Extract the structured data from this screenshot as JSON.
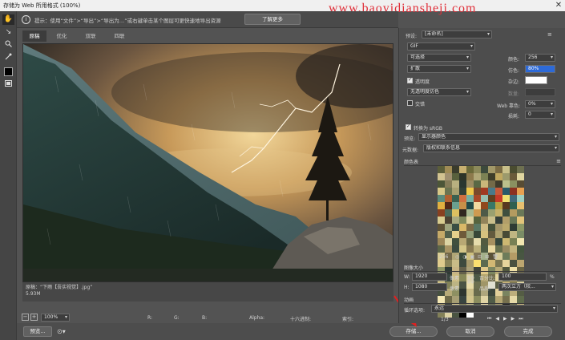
{
  "window": {
    "title": "存储为 Web 所用格式 (100%)",
    "close": "✕"
  },
  "watermark": "www.baoyidiansheji.com",
  "tools": [
    {
      "name": "hand-tool-icon",
      "glyph": "✋"
    },
    {
      "name": "slice-select-tool-icon",
      "glyph": "↘"
    },
    {
      "name": "zoom-tool-icon",
      "glyph": "🔍"
    },
    {
      "name": "eyedropper-tool-icon",
      "glyph": "✎"
    },
    {
      "name": "eyedropper-color-icon",
      "glyph": ""
    },
    {
      "name": "toggle-slice-icon",
      "glyph": "▣"
    }
  ],
  "hint": {
    "icon": "i",
    "text": "提示：使用“文件”>“导出”>“导出为…”或右键单击某个图层可更快速地导出资源",
    "button": "了解更多"
  },
  "tabs": [
    "原稿",
    "优化",
    "双联",
    "四联"
  ],
  "status": {
    "line1": "原稿：“下雨【吾实视觉】.jpg”",
    "line2": "5.93M"
  },
  "bottombar": {
    "zoom": "100%",
    "r": "R:",
    "g": "G:",
    "b": "B:",
    "alpha": "Alpha:",
    "hex": "十六进制:",
    "index": "索引:"
  },
  "footer": {
    "preview": "预览...",
    "save": "存储...",
    "cancel": "取消",
    "done": "完成"
  },
  "panel": {
    "preset_label": "预设:",
    "preset_value": "[未命名]",
    "format": "GIF",
    "reduction": "可选择",
    "dither_algo": "扩散",
    "transparency_label": "透明度",
    "matte_dither": "无透明度仿色",
    "interlace_label": "交错",
    "colors_label": "颜色:",
    "colors_value": "256",
    "dither_label": "仿色:",
    "dither_value": "80%",
    "matte_label": "杂边:",
    "amount_label": "数量:",
    "web_snap_label": "Web 靠色:",
    "web_snap_value": "0%",
    "lossy_label": "损耗:",
    "lossy_value": "0",
    "convert_srgb": "转换为 sRGB",
    "preview_label": "预览:",
    "preview_value": "显示器颜色",
    "metadata_label": "元数据:",
    "metadata_value": "版权和联系信息",
    "color_table_label": "颜色表",
    "color_count": "256",
    "image_size_label": "图像大小",
    "w_label": "W:",
    "w_value": "1920",
    "h_label": "H:",
    "h_value": "1080",
    "px_unit": "像素",
    "percent_label": "百分比:",
    "percent_value": "100",
    "percent_unit": "%",
    "quality_label": "品质:",
    "quality_value": "两次立方（较...",
    "animation_label": "动画",
    "loop_label": "循环选项:",
    "loop_value": "永远",
    "frame_counter": "1/3"
  },
  "palette": [
    "#5b5e3a",
    "#a08c55",
    "#3a3c2c",
    "#c8b070",
    "#6b6a3a",
    "#8c8a5a",
    "#3c4a3c",
    "#a29868",
    "#7a6b44",
    "#c9c08a",
    "#4a4c30",
    "#6e7050",
    "#d2c391",
    "#a09070",
    "#58603c",
    "#2e3428",
    "#8d7a4d",
    "#b0a878",
    "#7c8254",
    "#3e3e2a",
    "#c0a860",
    "#9c9a6c",
    "#6a5a3a",
    "#e0d6a0",
    "#4c5638",
    "#847c58",
    "#b8b080",
    "#2a3630",
    "#9a8a60",
    "#5a6844",
    "#cab77a",
    "#746a48",
    "#403c2c",
    "#bcc08c",
    "#8a9060",
    "#584c34",
    "#d8c888",
    "#6c7450",
    "#a8a070",
    "#324038",
    "#f0c84a",
    "#7a4a2c",
    "#a03a22",
    "#4a7a8a",
    "#c85a3a",
    "#2a5a6a",
    "#8c3020",
    "#e8a050",
    "#5c8c7c",
    "#b06030",
    "#3a6050",
    "#d07040",
    "#78b0a0",
    "#a84828",
    "#98c0b0",
    "#604020",
    "#c83a28",
    "#f0e070",
    "#406878",
    "#a0d0c0",
    "#e0b040",
    "#502818",
    "#6aa090",
    "#c89048",
    "#204848",
    "#f0d8a0",
    "#90481c",
    "#387868",
    "#b8a040",
    "#583820",
    "#306050",
    "#e8c070",
    "#884020",
    "#4a6a5a",
    "#dcc060",
    "#302820",
    "#a6b890",
    "#ce9a50",
    "#4d5a48",
    "#9aa070",
    "#c4b06a",
    "#3f4f3f",
    "#b39b60",
    "#6a7858",
    "#d8cc90",
    "#4c4232",
    "#a9aa80",
    "#7f8a5c",
    "#ddd2a0",
    "#56643e",
    "#92845a",
    "#cabf8c",
    "#36403a",
    "#b29e6a",
    "#677656",
    "#e2c47a",
    "#5e5236",
    "#9fa47e",
    "#3a4e44",
    "#d9b868",
    "#7d6c46",
    "#5a7864",
    "#cfbd84",
    "#46523a",
    "#a4966a",
    "#bba86c",
    "#2d3b34",
    "#8c9866",
    "#c6aa68",
    "#52604a",
    "#e4d08c",
    "#6e5a3a",
    "#94a078",
    "#384838",
    "#d6c27e",
    "#625a3e",
    "#aea270",
    "#484a36",
    "#c0b682",
    "#7a8c66",
    "#9c8658",
    "#dcd4a4",
    "#40503e",
    "#b8a874",
    "#6c6a48",
    "#e6dcac",
    "#525a40",
    "#a69060",
    "#34463c",
    "#cdb872",
    "#788054",
    "#f2e6b0",
    "#5c6648",
    "#a89464",
    "#3c4c40",
    "#d4c688",
    "#887a52",
    "#bcb07a",
    "#4e5c44",
    "#e8d8a0",
    "#66704e",
    "#9a8c62",
    "#c2b47e",
    "#44563e",
    "#dacc94",
    "#72684a",
    "#b0a676",
    "#3a4a3a",
    "#cec07e",
    "#807456",
    "#a4b08a",
    "#5a5238",
    "#d6cc98",
    "#6e7c5a",
    "#b49c66",
    "#485642",
    "#e0cc8e",
    "#8a8458",
    "#c8bc88",
    "#3e4a3e",
    "#a89a6c",
    "#fce070",
    "#5c6a50",
    "#d2b874",
    "#7a7652",
    "#e6d49c",
    "#4a5240",
    "#bca670",
    "#909866",
    "#2e3a34",
    "#c6b484",
    "#64604a",
    "#aaa078",
    "#40443a",
    "#dfc88a",
    "#7c8660",
    "#b8aa76",
    "#52583e",
    "#f0e2a8",
    "#6a6444",
    "#a29c70",
    "#3a4640",
    "#ccbc80",
    "#868858",
    "#dcd09c",
    "#4e5a46",
    "#b2a46e",
    "#726e4c",
    "#e4d6a0",
    "#5e6848",
    "#aa9a66",
    "#363e38",
    "#d0c28a",
    "#828258",
    "#bcb484",
    "#4a5444",
    "#e8dca8",
    "#6c7050",
    "#a09668",
    "#e0e0d0",
    "#5a5e44",
    "#c4b07a",
    "#7e7854",
    "#d8cea0",
    "#465040",
    "#b6aa78",
    "#8e9062",
    "#2e3630",
    "#cabe88",
    "#686a4c",
    "#aea67c",
    "#3c463c",
    "#e2d09a",
    "#7a8460",
    "#bcae7c",
    "#545c44",
    "#f4e8b4",
    "#6e6a48",
    "#a69e74",
    "#384440",
    "#d2c48c",
    "#8a8c5e",
    "#e0d4a4",
    "#505c48",
    "#b4a672",
    "#76704e",
    "#e6daa8",
    "#606c4c",
    "#ac9e6a",
    "#3a423a",
    "#d4c68e",
    "#86865a",
    "#c0b888",
    "#4c5646",
    "#ecdcaa",
    "#6e7454",
    "#a49a6e",
    "#1a1a1a",
    "#5e6246",
    "#c8b47e",
    "#828058",
    "#dcd2a4",
    "#4a5442",
    "#000000",
    "#ffffff"
  ]
}
